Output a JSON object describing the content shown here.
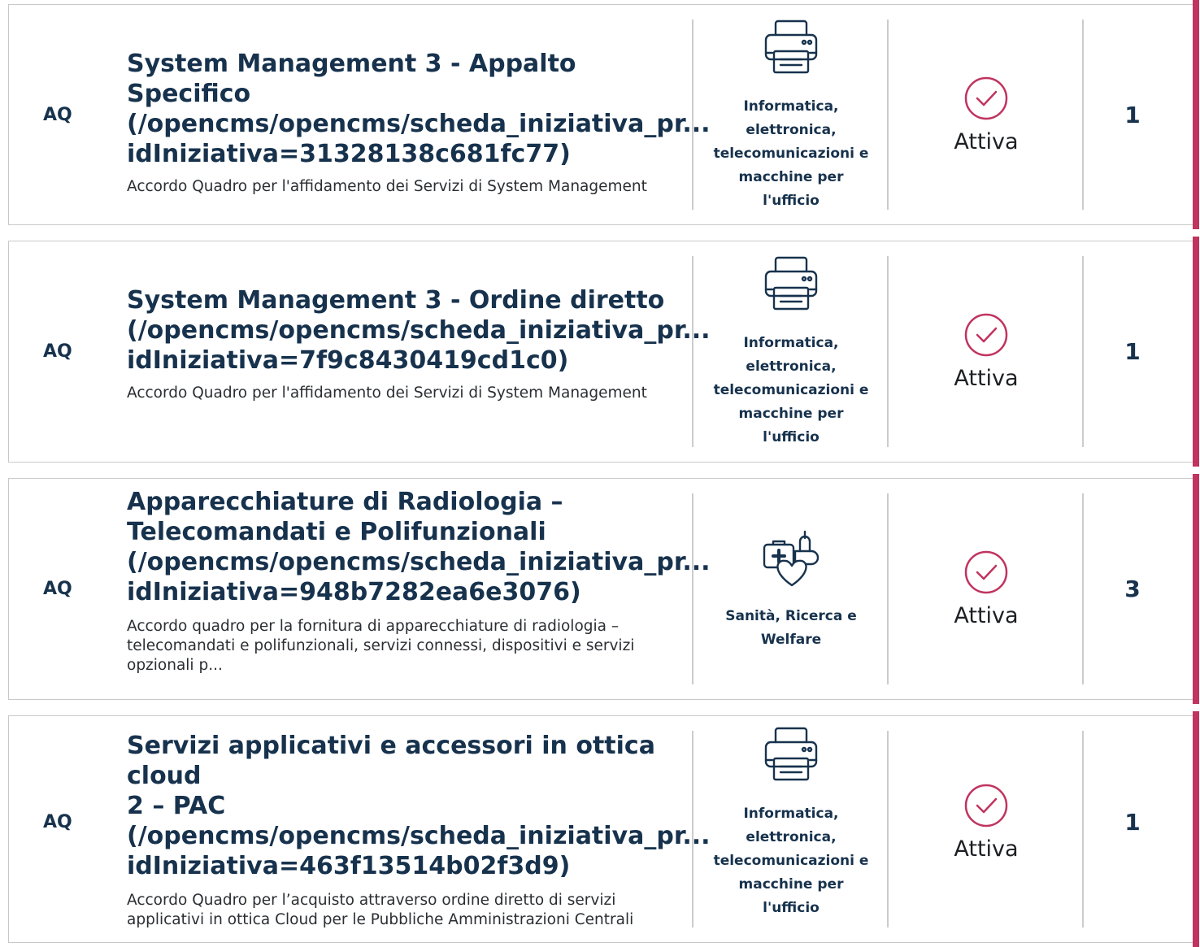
{
  "accent_color": "#c0345f",
  "items": [
    {
      "type": "AQ",
      "title_lines": [
        "System Management 3 - Appalto Specifico",
        "(/opencms/opencms/scheda_iniziativa_pr...",
        "idIniziativa=31328138c681fc77)"
      ],
      "description": "Accordo Quadro per l'affidamento dei Servizi di System Management",
      "category_icon": "printer-icon",
      "category": "Informatica, elettronica, telecomunicazioni e macchine per l'ufficio",
      "status_icon": "check-circle-icon",
      "status": "Attiva",
      "count": "1"
    },
    {
      "type": "AQ",
      "title_lines": [
        "System Management 3 - Ordine diretto",
        "(/opencms/opencms/scheda_iniziativa_pr...",
        "idIniziativa=7f9c8430419cd1c0)"
      ],
      "description": "Accordo Quadro per l'affidamento dei Servizi di System Management",
      "category_icon": "printer-icon",
      "category": "Informatica, elettronica, telecomunicazioni e macchine per l'ufficio",
      "status_icon": "check-circle-icon",
      "status": "Attiva",
      "count": "1"
    },
    {
      "type": "AQ",
      "title_lines": [
        "Apparecchiature di Radiologia –",
        "Telecomandati e Polifunzionali",
        "(/opencms/opencms/scheda_iniziativa_pr...",
        "idIniziativa=948b7282ea6e3076)"
      ],
      "description": "Accordo quadro per la fornitura di apparecchiature di radiologia – telecomandati e polifunzionali, servizi connessi, dispositivi e servizi opzionali p...",
      "category_icon": "healthcare-icon",
      "category": "Sanità, Ricerca e Welfare",
      "status_icon": "check-circle-icon",
      "status": "Attiva",
      "count": "3"
    },
    {
      "type": "AQ",
      "title_lines": [
        "Servizi applicativi e accessori in ottica cloud",
        "2 – PAC",
        "(/opencms/opencms/scheda_iniziativa_pr...",
        "idIniziativa=463f13514b02f3d9)"
      ],
      "description": "Accordo Quadro per l’acquisto attraverso ordine diretto di servizi applicativi in ottica Cloud per le Pubbliche Amministrazioni Centrali",
      "category_icon": "printer-icon",
      "category": "Informatica, elettronica, telecomunicazioni e macchine per l'ufficio",
      "status_icon": "check-circle-icon",
      "status": "Attiva",
      "count": "1"
    }
  ]
}
